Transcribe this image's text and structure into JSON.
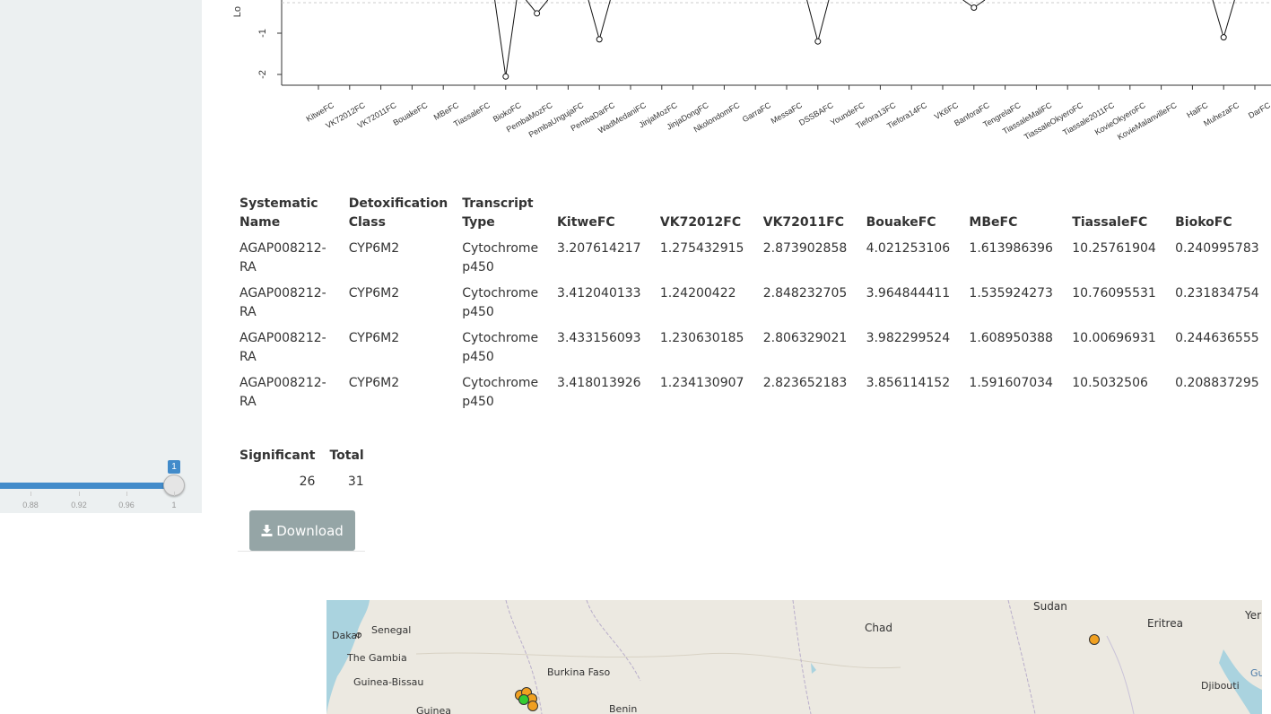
{
  "slider": {
    "value_label": "1",
    "ticks": [
      "0.88",
      "0.92",
      "0.96",
      "1"
    ],
    "accent": "#428bca"
  },
  "plot": {
    "ylabel_fragment": "Lo",
    "ytick_labels": [
      "-1",
      "-2"
    ],
    "categories": [
      "KitweFC",
      "VK72012FC",
      "VK72011FC",
      "BouakeFC",
      "MBeFC",
      "TiassaleFC",
      "BiokoFC",
      "PembaMozFC",
      "PembaUngujaFC",
      "PembaDarFC",
      "WadMedaniFC",
      "JinjaMozFC",
      "JinjaDongFC",
      "NkolondomFC",
      "GarraFC",
      "MessaFC",
      "DSSBAFC",
      "YoundeFC",
      "Tiefora13FC",
      "Tiefora14FC",
      "VK6FC",
      "BanforaFC",
      "TengrelaFC",
      "TiassaleMaliFC",
      "TiassaleOkyeroFC",
      "Tiassale2011FC",
      "KovieOkyeroFC",
      "KovieMalanvilleFC",
      "HalFC",
      "MuhezaFC",
      "DarFC"
    ]
  },
  "chart_data": {
    "type": "line",
    "ylabel": "Lo",
    "ylim": [
      -2.2,
      0.8
    ],
    "categories": [
      "KitweFC",
      "VK72012FC",
      "VK72011FC",
      "BouakeFC",
      "MBeFC",
      "TiassaleFC",
      "BiokoFC",
      "PembaMozFC",
      "PembaUngujaFC",
      "PembaDarFC",
      "WadMedaniFC",
      "JinjaMozFC",
      "JinjaDongFC",
      "NkolondomFC",
      "GarraFC",
      "MessaFC",
      "DSSBAFC",
      "YoundeFC",
      "Tiefora13FC",
      "Tiefora14FC",
      "VK6FC",
      "BanforaFC",
      "TengrelaFC",
      "TiassaleMaliFC",
      "TiassaleOkyeroFC",
      "Tiassale2011FC",
      "KovieOkyeroFC",
      "KovieMalanvilleFC",
      "HalFC",
      "MuhezaFC",
      "DarFC"
    ],
    "visible_points": [
      {
        "category": "BiokoFC",
        "value": -2.05
      },
      {
        "category": "PembaMozFC",
        "value": -0.52
      },
      {
        "category": "PembaDarFC",
        "value": -1.15
      },
      {
        "category": "DSSBAFC",
        "value": -1.2
      },
      {
        "category": "BanforaFC",
        "value": -0.38
      },
      {
        "category": "MuhezaFC",
        "value": -1.1
      }
    ]
  },
  "table": {
    "headers": [
      "Systematic Name",
      "Detoxification Class",
      "Transcript Type",
      "KitweFC",
      "VK72012FC",
      "VK72011FC",
      "BouakeFC",
      "MBeFC",
      "TiassaleFC",
      "BiokoFC"
    ],
    "rows": [
      [
        "AGAP008212-RA",
        "CYP6M2",
        "Cytochrome p450",
        "3.207614217",
        "1.275432915",
        "2.873902858",
        "4.021253106",
        "1.613986396",
        "10.25761904",
        "0.240995783"
      ],
      [
        "AGAP008212-RA",
        "CYP6M2",
        "Cytochrome p450",
        "3.412040133",
        "1.24200422",
        "2.848232705",
        "3.964844411",
        "1.535924273",
        "10.76095531",
        "0.231834754"
      ],
      [
        "AGAP008212-RA",
        "CYP6M2",
        "Cytochrome p450",
        "3.433156093",
        "1.230630185",
        "2.806329021",
        "3.982299524",
        "1.608950388",
        "10.00696931",
        "0.244636555"
      ],
      [
        "AGAP008212-RA",
        "CYP6M2",
        "Cytochrome p450",
        "3.418013926",
        "1.234130907",
        "2.823652183",
        "3.856114152",
        "1.591607034",
        "10.5032506",
        "0.208837295"
      ]
    ]
  },
  "summary": {
    "headers": [
      "Significant",
      "Total"
    ],
    "values": [
      "26",
      "31"
    ]
  },
  "download": {
    "label": "Download",
    "icon": "download-icon"
  },
  "map": {
    "labels": [
      "Senegal",
      "Dakar",
      "The Gambia",
      "Guinea-Bissau",
      "Guinea",
      "Burkina Faso",
      "Benin",
      "Chad",
      "Sudan",
      "Eritrea",
      "Djibouti",
      "Yer",
      "Gu"
    ],
    "marker_colors": {
      "orange": "#f0a020",
      "green": "#33cc33"
    }
  }
}
